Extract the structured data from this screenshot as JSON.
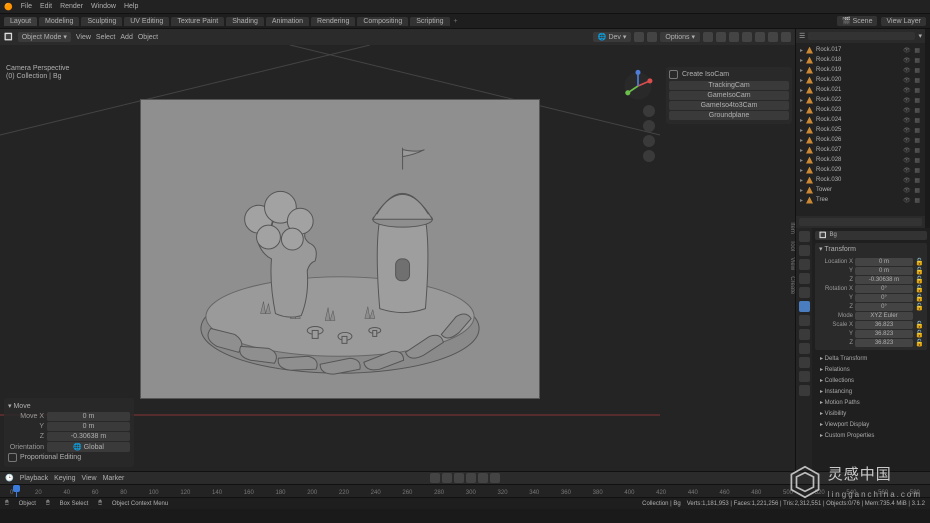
{
  "app": {
    "menu": [
      "File",
      "Edit",
      "Render",
      "Window",
      "Help"
    ],
    "workspaces": [
      "Layout",
      "Modeling",
      "Sculpting",
      "UV Editing",
      "Texture Paint",
      "Shading",
      "Animation",
      "Rendering",
      "Compositing",
      "Scripting"
    ],
    "scene_label": "Scene",
    "viewlayer_label": "View Layer"
  },
  "viewport": {
    "mode": "Object Mode",
    "menus": [
      "View",
      "Select",
      "Add",
      "Object"
    ],
    "overlay_title": "Camera Perspective",
    "overlay_sub": "(0) Collection | Bg",
    "options_label": "Options",
    "dev_label": "Dev",
    "orientation_label": "Global"
  },
  "floating": {
    "title": "Create IsoCam",
    "buttons": [
      "TrackingCam",
      "GameIsoCam",
      "GameIso4to3Cam",
      "Groundplane"
    ]
  },
  "move_panel": {
    "title": "Move",
    "x_label": "Move X",
    "x_val": "0 m",
    "y_label": "Y",
    "y_val": "0 m",
    "z_label": "Z",
    "z_val": "-0.30638 m",
    "orientation_label": "Orientation",
    "orientation_val": "Global",
    "prop_label": "Proportional Editing"
  },
  "outliner": {
    "search_placeholder": "",
    "items": [
      {
        "name": "Rock.017"
      },
      {
        "name": "Rock.018"
      },
      {
        "name": "Rock.019"
      },
      {
        "name": "Rock.020"
      },
      {
        "name": "Rock.021"
      },
      {
        "name": "Rock.022"
      },
      {
        "name": "Rock.023"
      },
      {
        "name": "Rock.024"
      },
      {
        "name": "Rock.025"
      },
      {
        "name": "Rock.026"
      },
      {
        "name": "Rock.027"
      },
      {
        "name": "Rock.028"
      },
      {
        "name": "Rock.029"
      },
      {
        "name": "Rock.030"
      },
      {
        "name": "Tower"
      },
      {
        "name": "Tree"
      }
    ]
  },
  "properties": {
    "crumb": "Bg",
    "transform": {
      "title": "Transform",
      "loc_label": "Location X",
      "loc_x": "0 m",
      "loc_y": "0 m",
      "loc_z": "-0.30638 m",
      "rot_label": "Rotation X",
      "rot_x": "0°",
      "rot_y": "0°",
      "rot_z": "0°",
      "mode_label": "Mode",
      "mode_val": "XYZ Euler",
      "scale_label": "Scale X",
      "scale_x": "36.823",
      "scale_y": "36.823",
      "scale_z": "36.823"
    },
    "sections": [
      "Delta Transform",
      "Relations",
      "Collections",
      "Instancing",
      "Motion Paths",
      "Visibility",
      "Viewport Display",
      "Custom Properties"
    ]
  },
  "timeline": {
    "menus": [
      "Playback",
      "Keying",
      "View",
      "Marker"
    ],
    "ticks": [
      "0",
      "20",
      "40",
      "60",
      "80",
      "100",
      "120",
      "140",
      "160",
      "180",
      "200",
      "220",
      "240",
      "260",
      "280",
      "300",
      "320",
      "340",
      "360",
      "380",
      "400",
      "420",
      "440",
      "460",
      "480",
      "500",
      "520",
      "540",
      "560",
      "580"
    ]
  },
  "status": {
    "left": [
      "Object",
      "Box Select"
    ],
    "mid": "Object Context Menu",
    "collection": "Collection | Bg",
    "stats": "Verts:1,181,953 | Faces:1,221,256 | Tris:2,312,551 | Objects:0/76 | Mem:735.4 MiB | 3.1.2"
  },
  "watermark": {
    "cn": "灵感中国",
    "dom": "lingganchina.com"
  }
}
